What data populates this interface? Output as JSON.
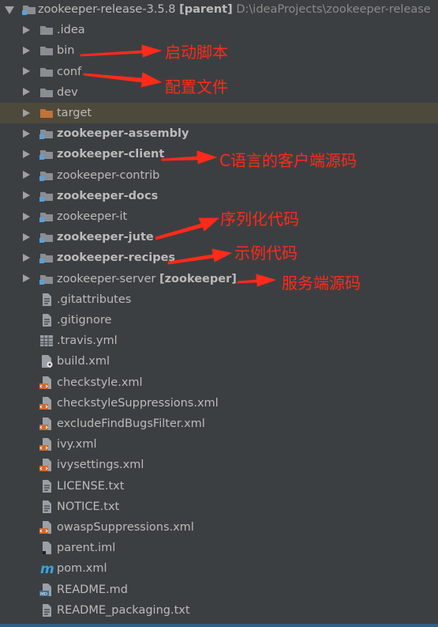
{
  "project": {
    "name": "zookeeper-release-3.5.8",
    "tag": "[parent]",
    "path": "D:\\ideaProjects\\zookeeper-release"
  },
  "items": [
    {
      "label": "zookeeper-release-3.5.8",
      "kind": "root",
      "icon": "module-folder-icon"
    },
    {
      "label": ".idea",
      "kind": "folder",
      "icon": "folder-icon",
      "bold": false
    },
    {
      "label": "bin",
      "kind": "folder",
      "icon": "folder-icon",
      "bold": false
    },
    {
      "label": "conf",
      "kind": "folder",
      "icon": "folder-icon",
      "bold": false
    },
    {
      "label": "dev",
      "kind": "folder",
      "icon": "folder-icon",
      "bold": false
    },
    {
      "label": "target",
      "kind": "folder",
      "icon": "excluded-folder-icon",
      "bold": false,
      "selected": true
    },
    {
      "label": "zookeeper-assembly",
      "kind": "module",
      "icon": "module-folder-icon",
      "bold": true
    },
    {
      "label": "zookeeper-client",
      "kind": "module",
      "icon": "module-folder-icon",
      "bold": true
    },
    {
      "label": "zookeeper-contrib",
      "kind": "module",
      "icon": "module-folder-icon",
      "bold": false
    },
    {
      "label": "zookeeper-docs",
      "kind": "module",
      "icon": "module-folder-icon",
      "bold": true
    },
    {
      "label": "zookeeper-it",
      "kind": "module",
      "icon": "module-folder-icon",
      "bold": false
    },
    {
      "label": "zookeeper-jute",
      "kind": "module",
      "icon": "module-folder-icon",
      "bold": true
    },
    {
      "label": "zookeeper-recipes",
      "kind": "module",
      "icon": "module-folder-icon",
      "bold": true
    },
    {
      "label": "zookeeper-server",
      "kind": "module",
      "icon": "module-folder-icon",
      "bold": false,
      "suffix": "[zookeeper]"
    },
    {
      "label": ".gitattributes",
      "kind": "file",
      "icon": "text-file-icon"
    },
    {
      "label": ".gitignore",
      "kind": "file",
      "icon": "text-file-icon"
    },
    {
      "label": ".travis.yml",
      "kind": "file",
      "icon": "yaml-file-icon"
    },
    {
      "label": "build.xml",
      "kind": "file",
      "icon": "ant-build-file-icon"
    },
    {
      "label": "checkstyle.xml",
      "kind": "file",
      "icon": "xml-file-icon"
    },
    {
      "label": "checkstyleSuppressions.xml",
      "kind": "file",
      "icon": "xml-file-icon"
    },
    {
      "label": "excludeFindBugsFilter.xml",
      "kind": "file",
      "icon": "xml-file-icon"
    },
    {
      "label": "ivy.xml",
      "kind": "file",
      "icon": "xml-file-icon"
    },
    {
      "label": "ivysettings.xml",
      "kind": "file",
      "icon": "xml-file-icon"
    },
    {
      "label": "LICENSE.txt",
      "kind": "file",
      "icon": "text-file-icon"
    },
    {
      "label": "NOTICE.txt",
      "kind": "file",
      "icon": "text-file-icon"
    },
    {
      "label": "owaspSuppressions.xml",
      "kind": "file",
      "icon": "xml-file-icon"
    },
    {
      "label": "parent.iml",
      "kind": "file",
      "icon": "iml-file-icon"
    },
    {
      "label": "pom.xml",
      "kind": "file",
      "icon": "maven-pom-icon"
    },
    {
      "label": "README.md",
      "kind": "file",
      "icon": "markdown-file-icon"
    },
    {
      "label": "README_packaging.txt",
      "kind": "file",
      "icon": "text-file-icon"
    }
  ],
  "annotations": {
    "bin": "启动脚本",
    "conf": "配置文件",
    "client": "C语言的客户端源码",
    "jute": "序列化代码",
    "recipes": "示例代码",
    "server": "服务端源码"
  },
  "colors": {
    "background": "#3c3f41",
    "selected_row": "#4e4a3b",
    "annotation": "#ff2a1a",
    "folder": "#8a8e93",
    "excluded_folder": "#c27236",
    "xml_icon": "#d06a30",
    "maven": "#39a3e2"
  }
}
